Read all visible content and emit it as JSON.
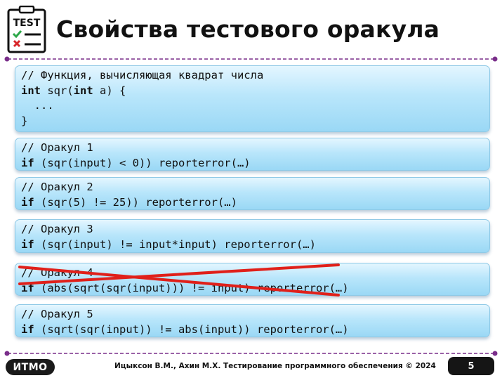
{
  "header": {
    "logo_text": "TEST",
    "title": "Свойства тестового оракула"
  },
  "blocks": [
    {
      "lines": [
        [
          {
            "t": "// Функция, вычисляющая квадрат числа",
            "kw": false
          }
        ],
        [
          {
            "t": "int",
            "kw": true
          },
          {
            "t": " sqr(",
            "kw": false
          },
          {
            "t": "int",
            "kw": true
          },
          {
            "t": " a) {",
            "kw": false
          }
        ],
        [
          {
            "t": "  ...",
            "kw": false
          }
        ],
        [
          {
            "t": "}",
            "kw": false
          }
        ]
      ]
    },
    {
      "lines": [
        [
          {
            "t": "// Оракул 1",
            "kw": false
          }
        ],
        [
          {
            "t": "if",
            "kw": true
          },
          {
            "t": " (sqr(input) < 0)) reporterror(…)",
            "kw": false
          }
        ]
      ]
    },
    {
      "lines": [
        [
          {
            "t": "// Оракул 2",
            "kw": false
          }
        ],
        [
          {
            "t": "if",
            "kw": true
          },
          {
            "t": " (sqr(5) != 25)) reporterror(…)",
            "kw": false
          }
        ]
      ]
    },
    {
      "lines": [
        [
          {
            "t": "// Оракул 3",
            "kw": false
          }
        ],
        [
          {
            "t": "if",
            "kw": true
          },
          {
            "t": " (sqr(input) != input*input) reporterror(…)",
            "kw": false
          }
        ]
      ]
    },
    {
      "lines": [
        [
          {
            "t": "// Оракул 4",
            "kw": false
          }
        ],
        [
          {
            "t": "if",
            "kw": true
          },
          {
            "t": " (abs(sqrt(sqr(input))) != input) reporterror(…)",
            "kw": false
          }
        ]
      ],
      "crossed_out": true
    },
    {
      "lines": [
        [
          {
            "t": "// Оракул 5",
            "kw": false
          }
        ],
        [
          {
            "t": "if",
            "kw": true
          },
          {
            "t": " (sqrt(sqr(input)) != abs(input)) reporterror(…)",
            "kw": false
          }
        ]
      ]
    }
  ],
  "footer": {
    "logo": "ИТМО",
    "text": "Ицыксон В.М., Ахин М.Х. Тестирование программного обеспечения © 2024",
    "page_number": "5"
  },
  "colors": {
    "divider": "#7a2e8a",
    "box_light": "#e4f6ff",
    "box_dark": "#9ad8f5",
    "strike": "#e0201a",
    "check": "#2ea84a",
    "cross": "#d8262a"
  }
}
